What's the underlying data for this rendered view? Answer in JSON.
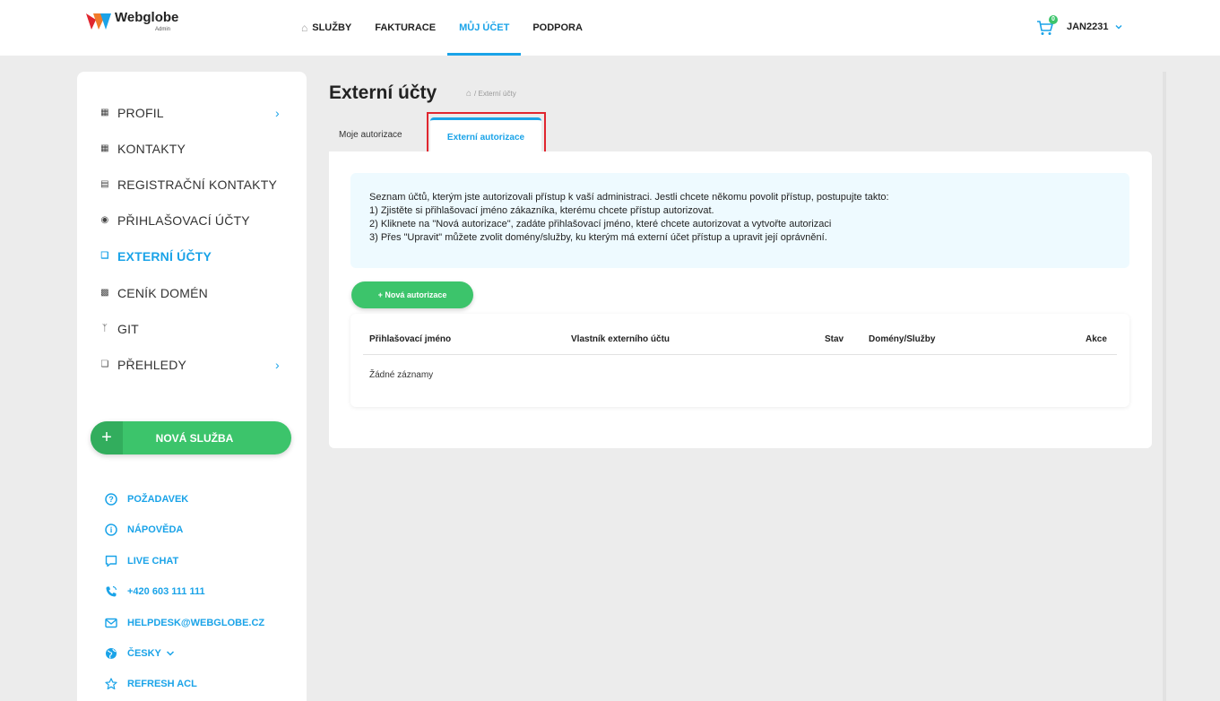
{
  "brand": {
    "name": "Webglobe",
    "sub": "Admin",
    "mark_colors": [
      "#e0262f",
      "#1aa3e8"
    ]
  },
  "topnav": [
    {
      "label": "SLUŽBY",
      "icon": "house-icon",
      "active": false
    },
    {
      "label": "FAKTURACE",
      "active": false
    },
    {
      "label": "MŮJ ÚČET",
      "active": true
    },
    {
      "label": "PODPORA",
      "active": false
    }
  ],
  "cart": {
    "count": "0"
  },
  "user": {
    "name": "JAN2231"
  },
  "sidebar": {
    "items": [
      {
        "label": "PROFIL",
        "icon": "id-card-icon",
        "chevron": true
      },
      {
        "label": "KONTAKTY",
        "icon": "contact-card-icon"
      },
      {
        "label": "REGISTRAČNÍ KONTAKTY",
        "icon": "list-icon"
      },
      {
        "label": "PŘIHLAŠOVACÍ ÚČTY",
        "icon": "users-icon"
      },
      {
        "label": "EXTERNÍ ÚČTY",
        "icon": "windows-icon",
        "active": true
      },
      {
        "label": "CENÍK DOMÉN",
        "icon": "money-icon"
      },
      {
        "label": "GIT",
        "icon": "git-branch-icon"
      },
      {
        "label": "PŘEHLEDY",
        "icon": "windows-icon",
        "chevron": true
      }
    ],
    "new_service": {
      "plus": "+",
      "label": "NOVÁ SLUŽBA"
    },
    "help": [
      {
        "label": "POŽADAVEK",
        "icon": "question-icon"
      },
      {
        "label": "NÁPOVĚDA",
        "icon": "info-icon"
      },
      {
        "label": "LIVE CHAT",
        "icon": "chat-icon"
      },
      {
        "label": "+420 603 111 111",
        "icon": "phone-icon"
      },
      {
        "label": "HELPDESK@WEBGLOBE.CZ",
        "icon": "mail-icon"
      },
      {
        "label": "ČESKY",
        "icon": "globe-icon"
      },
      {
        "label": "REFRESH ACL",
        "icon": "star-icon"
      }
    ]
  },
  "page": {
    "title": "Externí účty",
    "breadcrumb": "/ Externí účty",
    "tabs": [
      {
        "label": "Moje autorizace",
        "active": false
      },
      {
        "label": "Externí autorizace",
        "active": true
      }
    ],
    "info_lines": [
      "Seznam účtů, kterým jste autorizovali přístup k vaší administraci. Jestli chcete někomu povolit přístup, postupujte takto:",
      "1) Zjistěte si přihlašovací jméno zákazníka, kterému chcete přístup autorizovat.",
      "2) Kliknete na \"Nová autorizace\", zadáte přihlašovací jméno, které chcete autorizovat a vytvořte autorizaci",
      "3) Přes \"Upravit\" můžete zvolit domény/služby, ku kterým má externí účet přístup a upravit její oprávnění."
    ],
    "new_auth_button": "+ Nová autorizace",
    "table": {
      "columns": [
        "Přihlašovací jméno",
        "Vlastník externího účtu",
        "Stav",
        "Domény/Služby",
        "Akce"
      ],
      "empty_text": "Žádné záznamy"
    }
  },
  "colors": {
    "accent": "#1aa3e8",
    "green": "#3cc46b",
    "highlight": "#e0262f",
    "background": "#ececec"
  }
}
